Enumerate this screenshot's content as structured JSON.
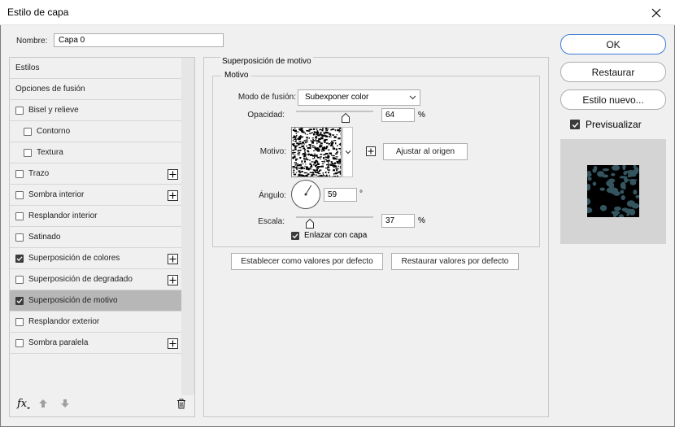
{
  "window": {
    "title": "Estilo de capa"
  },
  "name": {
    "label": "Nombre:",
    "value": "Capa 0"
  },
  "styles_list": [
    {
      "label": "Estilos",
      "checkbox": false,
      "checked": false,
      "plus": false,
      "indent": false
    },
    {
      "label": "Opciones de fusión",
      "checkbox": false,
      "checked": false,
      "plus": false,
      "indent": false
    },
    {
      "label": "Bisel y relieve",
      "checkbox": true,
      "checked": false,
      "plus": false,
      "indent": false
    },
    {
      "label": "Contorno",
      "checkbox": true,
      "checked": false,
      "plus": false,
      "indent": true
    },
    {
      "label": "Textura",
      "checkbox": true,
      "checked": false,
      "plus": false,
      "indent": true
    },
    {
      "label": "Trazo",
      "checkbox": true,
      "checked": false,
      "plus": true,
      "indent": false
    },
    {
      "label": "Sombra interior",
      "checkbox": true,
      "checked": false,
      "plus": true,
      "indent": false
    },
    {
      "label": "Resplandor interior",
      "checkbox": true,
      "checked": false,
      "plus": false,
      "indent": false
    },
    {
      "label": "Satinado",
      "checkbox": true,
      "checked": false,
      "plus": false,
      "indent": false
    },
    {
      "label": "Superposición de colores",
      "checkbox": true,
      "checked": true,
      "plus": true,
      "indent": false
    },
    {
      "label": "Superposición de degradado",
      "checkbox": true,
      "checked": false,
      "plus": true,
      "indent": false
    },
    {
      "label": "Superposición de motivo",
      "checkbox": true,
      "checked": true,
      "plus": false,
      "indent": false,
      "selected": true
    },
    {
      "label": "Resplandor exterior",
      "checkbox": true,
      "checked": false,
      "plus": false,
      "indent": false
    },
    {
      "label": "Sombra paralela",
      "checkbox": true,
      "checked": false,
      "plus": true,
      "indent": false
    }
  ],
  "footer": {
    "fx_label": "fx"
  },
  "main": {
    "section_title": "Superposición de motivo",
    "group_title": "Motivo",
    "blend_mode": {
      "label": "Modo de fusión:",
      "value": "Subexponer color"
    },
    "opacity": {
      "label": "Opacidad:",
      "value": "64",
      "unit": "%",
      "fraction": 0.64
    },
    "pattern": {
      "label": "Motivo:",
      "snap_button": "Ajustar al origen"
    },
    "angle": {
      "label": "Ángulo:",
      "value": "59",
      "unit": "°",
      "degrees": 59
    },
    "scale": {
      "label": "Escala:",
      "value": "37",
      "unit": "%",
      "fraction": 0.18
    },
    "link": {
      "label": "Enlazar con capa",
      "checked": true
    },
    "set_default_button": "Establecer como valores por defecto",
    "reset_default_button": "Restaurar valores por defecto"
  },
  "right": {
    "ok_button": "OK",
    "reset_button": "Restaurar",
    "new_style_button": "Estilo nuevo...",
    "preview": {
      "label": "Previsualizar",
      "checked": true
    }
  },
  "colors": {
    "accent": "#3b7bd6",
    "selection": "#b7b7b7",
    "preview_blob": "#34555f"
  }
}
